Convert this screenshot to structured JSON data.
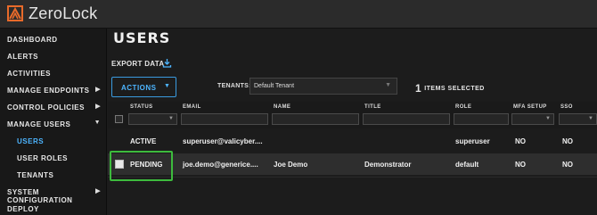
{
  "app": {
    "name": "ZeroLock"
  },
  "sidebar": {
    "items": [
      {
        "label": "DASHBOARD",
        "arrow": ""
      },
      {
        "label": "ALERTS",
        "arrow": ""
      },
      {
        "label": "ACTIVITIES",
        "arrow": ""
      },
      {
        "label": "MANAGE ENDPOINTS",
        "arrow": "▶"
      },
      {
        "label": "CONTROL POLICIES",
        "arrow": "▶"
      },
      {
        "label": "MANAGE USERS",
        "arrow": "▼"
      },
      {
        "label": "USERS",
        "arrow": ""
      },
      {
        "label": "USER ROLES",
        "arrow": ""
      },
      {
        "label": "TENANTS",
        "arrow": ""
      },
      {
        "label": "SYSTEM CONFIGURATION",
        "arrow": "▶"
      },
      {
        "label": "DEPLOY",
        "arrow": ""
      }
    ],
    "active": "USERS",
    "accent": "#4db5ff"
  },
  "main": {
    "title": "USERS",
    "export_label": "EXPORT DATA",
    "actions_label": "ACTIONS",
    "tenants_label": "TENANTS:",
    "tenant_value": "Default Tenant",
    "selected_count": "1",
    "selected_text": "ITEMS SELECTED"
  },
  "table": {
    "columns": [
      "STATUS",
      "EMAIL",
      "NAME",
      "TITLE",
      "ROLE",
      "MFA SETUP",
      "SSO"
    ],
    "rows": [
      {
        "status": "ACTIVE",
        "email": "superuser@valicyber....",
        "name": "",
        "title": "",
        "role": "superuser",
        "mfa": "NO",
        "sso": "NO",
        "selected": false
      },
      {
        "status": "PENDING",
        "email": "joe.demo@generice....",
        "name": "Joe Demo",
        "title": "Demonstrator",
        "role": "default",
        "mfa": "NO",
        "sso": "NO",
        "selected": true
      }
    ],
    "highlight_color": "#3dbb3d"
  }
}
